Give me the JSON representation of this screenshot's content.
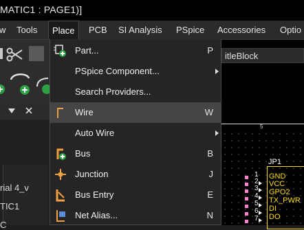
{
  "titlebar": {
    "title": "MATIC1 : PAGE1)]"
  },
  "menubar": {
    "items": [
      "w",
      "Tools",
      "Place",
      "PCB",
      "SI Analysis",
      "PSpice",
      "Accessories",
      "Optio"
    ]
  },
  "place_menu": {
    "items": [
      {
        "label": "Part...",
        "shortcut": "P",
        "icon": "part-icon"
      },
      {
        "label": "PSpice Component...",
        "submenu": true
      },
      {
        "label": "Search Providers..."
      },
      {
        "label": "Wire",
        "shortcut": "W",
        "icon": "wire-icon",
        "highlighted": true
      },
      {
        "label": "Auto Wire",
        "submenu": true
      },
      {
        "label": "Bus",
        "shortcut": "B",
        "icon": "bus-icon"
      },
      {
        "label": "Junction",
        "shortcut": "J",
        "icon": "junction-icon"
      },
      {
        "label": "Bus Entry",
        "shortcut": "E",
        "icon": "bus-entry-icon"
      },
      {
        "label": "Net Alias...",
        "shortcut": "N",
        "icon": "net-alias-icon"
      }
    ]
  },
  "toolbar": {
    "titleblock_field": "itleBlock"
  },
  "left_panel": {
    "line1": "rial 4_v",
    "line2": "TIC1",
    "line3": "C"
  },
  "schematic": {
    "ruler_label": "5",
    "part_ref": "JP1",
    "pins": [
      {
        "num": "1",
        "name": "GND"
      },
      {
        "num": "2",
        "name": "VCC"
      },
      {
        "num": "3",
        "name": "GPO2"
      },
      {
        "num": "4",
        "name": "TX_PWR"
      },
      {
        "num": "5",
        "name": "DI"
      },
      {
        "num": "6",
        "name": "DO"
      },
      {
        "num": "7",
        "name": ""
      }
    ]
  },
  "colors": {
    "accent_pin": "#ff7fd0",
    "part_text": "#ffdd00",
    "menu_bg": "#252526",
    "highlight": "#454545"
  }
}
